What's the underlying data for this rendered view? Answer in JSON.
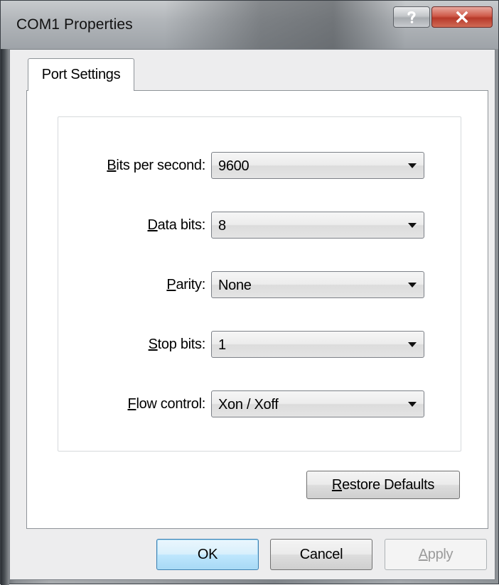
{
  "window": {
    "title": "COM1 Properties",
    "help_icon": "question-icon",
    "close_icon": "close-icon"
  },
  "tabs": [
    {
      "label": "Port Settings",
      "selected": true
    }
  ],
  "settings": {
    "bits_per_second": {
      "label_mnemonic": "B",
      "label_rest": "its per second:",
      "value": "9600"
    },
    "data_bits": {
      "label_mnemonic": "D",
      "label_rest": "ata bits:",
      "value": "8"
    },
    "parity": {
      "label_mnemonic": "P",
      "label_rest": "arity:",
      "value": "None"
    },
    "stop_bits": {
      "label_mnemonic": "S",
      "label_rest": "top bits:",
      "value": "1"
    },
    "flow_control": {
      "label_mnemonic": "F",
      "label_rest": "low control:",
      "value": "Xon / Xoff"
    }
  },
  "buttons": {
    "restore_mnemonic": "R",
    "restore_rest": "estore Defaults",
    "ok": "OK",
    "cancel": "Cancel",
    "apply_mnemonic": "A",
    "apply_rest": "pply"
  },
  "colors": {
    "ok_border": "#3c7fb1",
    "close_button": "#c8493a",
    "disabled_text": "#9b9b9b"
  }
}
